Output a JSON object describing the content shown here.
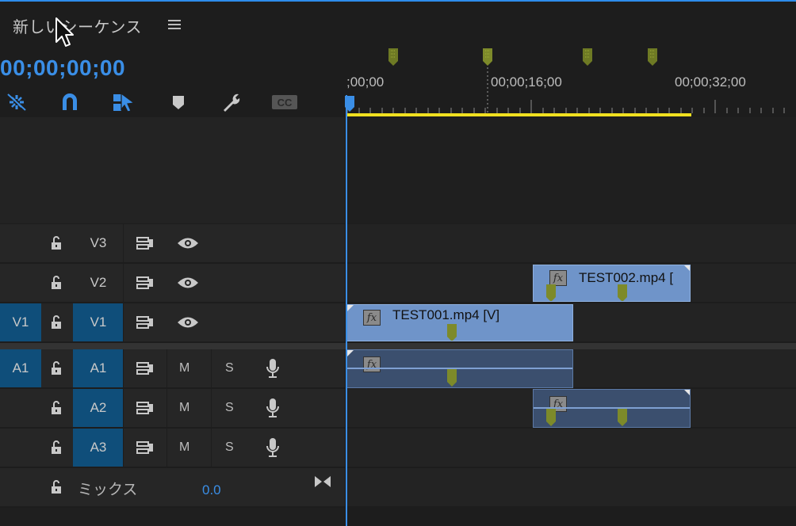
{
  "sequence": {
    "title": "新しいシーケンス",
    "menu_icon": "hamburger-icon"
  },
  "timecode": "00;00;00;00",
  "toolbar": [
    {
      "name": "snap-nest-icon",
      "active": true
    },
    {
      "name": "magnet-snap-icon",
      "active": true
    },
    {
      "name": "linked-selection-icon",
      "active": true
    },
    {
      "name": "add-marker-icon",
      "active": false
    },
    {
      "name": "wrench-settings-icon",
      "active": false
    },
    {
      "name": "closed-captions-icon",
      "active": false,
      "label": "CC"
    }
  ],
  "ruler": {
    "labels": [
      ";00;00",
      "00;00;16;00",
      "00;00;32;00"
    ]
  },
  "tracks": {
    "video": [
      {
        "id": "V3",
        "source_patch": "",
        "targeted": false
      },
      {
        "id": "V2",
        "source_patch": "",
        "targeted": false
      },
      {
        "id": "V1",
        "source_patch": "V1",
        "targeted": true
      }
    ],
    "audio": [
      {
        "id": "A1",
        "source_patch": "A1",
        "targeted": true,
        "mute": "M",
        "solo": "S"
      },
      {
        "id": "A2",
        "source_patch": "",
        "targeted": true,
        "mute": "M",
        "solo": "S"
      },
      {
        "id": "A3",
        "source_patch": "",
        "targeted": true,
        "mute": "M",
        "solo": "S"
      }
    ]
  },
  "mix": {
    "label": "ミックス",
    "value": "0.0"
  },
  "clips": {
    "v1": {
      "name": "TEST001.mp4 [V]",
      "fx": "fx"
    },
    "v2": {
      "name": "TEST002.mp4 [",
      "fx": "fx"
    },
    "a1": {
      "fx": "fx"
    },
    "a2": {
      "fx": "fx"
    }
  },
  "colors": {
    "accent": "#3a8ee6",
    "targeted": "#0f4e7a",
    "video_clip": "#6f94c9",
    "audio_clip": "#3b4f6e",
    "work_area": "#f0e020",
    "marker": "#7d8a2a"
  }
}
